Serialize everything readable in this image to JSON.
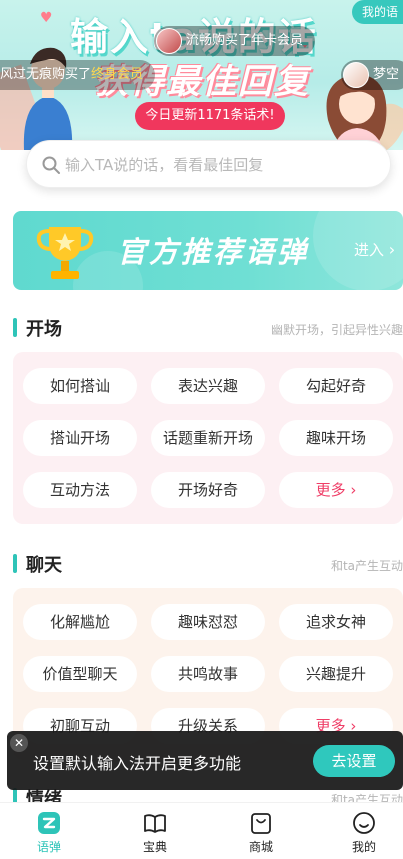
{
  "hero": {
    "title_line1": "输入ta说的话",
    "title_line2": "获得最佳回复",
    "update_text": "今日更新1171条话术!",
    "purchase_ticker_1": "流畅购买了年卡会员",
    "purchase_ticker_2_prefix": "风过无痕购买了",
    "purchase_ticker_2_highlight": "终身会员",
    "purchase_ticker_3": "梦空",
    "corner_tag": "我的语"
  },
  "search": {
    "placeholder": "输入TA说的话，看看最佳回复"
  },
  "recommend": {
    "title": "官方推荐语弹",
    "enter_label": "进入"
  },
  "sections": [
    {
      "title": "开场",
      "subtitle": "幽默开场，引起异性兴趣",
      "chips": [
        "如何搭讪",
        "表达兴趣",
        "勾起好奇",
        "搭讪开场",
        "话题重新开场",
        "趣味开场",
        "互动方法",
        "开场好奇"
      ],
      "more_label": "更多"
    },
    {
      "title": "聊天",
      "subtitle": "和ta产生互动",
      "chips": [
        "化解尴尬",
        "趣味怼怼",
        "追求女神",
        "价值型聊天",
        "共鸣故事",
        "兴趣提升",
        "初聊互动",
        "升级关系"
      ],
      "more_label": "更多"
    },
    {
      "title": "情绪",
      "subtitle": "和ta产生互动"
    }
  ],
  "toast": {
    "message": "设置默认输入法开启更多功能",
    "button_label": "去设置",
    "close_glyph": "✕"
  },
  "nav": {
    "items": [
      {
        "label": "语弹",
        "icon": "bolt-icon",
        "active": true
      },
      {
        "label": "宝典",
        "icon": "book-icon",
        "active": false
      },
      {
        "label": "商城",
        "icon": "bag-icon",
        "active": false
      },
      {
        "label": "我的",
        "icon": "smile-icon",
        "active": false
      }
    ]
  },
  "colors": {
    "accent": "#2ec4b8",
    "highlight": "#ef3e67",
    "update_badge": "#f0375d"
  }
}
